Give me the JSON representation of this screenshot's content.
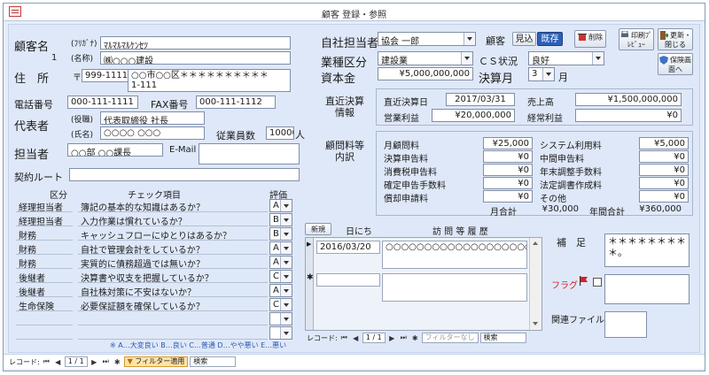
{
  "window": {
    "title": "顧客 登録・参照"
  },
  "customer": {
    "name_label": "顧客名",
    "kana_label": "(ﾌﾘｶﾞﾅ)",
    "kana": "ﾏﾙﾏﾙﾏﾙｹﾝｾﾂ",
    "id": "1",
    "name_sub_label": "(名称)",
    "name": "㈱○○○建設",
    "address_label": "住　所",
    "postal_mark": "〒",
    "postal": "999-1111",
    "address": "○○市○○区＊＊＊＊＊＊＊＊＊＊\n1-111",
    "phone_label": "電話番号",
    "phone": "000-111-1111",
    "fax_label": "FAX番号",
    "fax": "000-111-1112",
    "rep_label": "代表者",
    "rep_title_label": "(役職)",
    "rep_title": "代表取締役 社長",
    "rep_name_label": "(氏名)",
    "rep_name": "○○○○ ○○○",
    "employees_label": "従業員数",
    "employees": "10000",
    "employees_unit": "人",
    "contact_label": "担当者",
    "contact": "○○部 ○○課長",
    "email_label": "E-Mail",
    "email": "",
    "route_label": "契約ルート",
    "route": ""
  },
  "header_right": {
    "staff_label": "自社担当者",
    "staff": "協会 一郎",
    "customer_type_label": "顧客",
    "prospect_btn": "見込",
    "existing_btn": "既存",
    "industry_label": "業種区分",
    "industry": "建設業",
    "cs_label": "ＣＳ状況",
    "cs": "良好",
    "capital_label": "資本金",
    "capital": "¥5,000,000,000",
    "fiscal_label": "決算月",
    "fiscal_month": "3",
    "fiscal_unit": "月"
  },
  "toolbar": {
    "delete": "削除",
    "print_preview": "印刷ﾌﾟﾚﾋﾞｭｰ",
    "update_close": "更新・閉じる",
    "insurance_view": "保険画面へ"
  },
  "recent": {
    "section_label": "直近決算情報",
    "date_label": "直近決算日",
    "date": "2017/03/31",
    "sales_label": "売上高",
    "sales": "¥1,500,000,000",
    "op_profit_label": "営業利益",
    "op_profit": "¥20,000,000",
    "ord_profit_label": "経常利益",
    "ord_profit": "¥0"
  },
  "fees": {
    "section_label": "顧問料等内訳",
    "left": [
      {
        "label": "月顧問料",
        "value": "¥25,000"
      },
      {
        "label": "決算申告料",
        "value": "¥0"
      },
      {
        "label": "消費税申告料",
        "value": "¥0"
      },
      {
        "label": "確定申告手数料",
        "value": "¥0"
      },
      {
        "label": "償却申請料",
        "value": "¥0"
      }
    ],
    "right": [
      {
        "label": "システム利用料",
        "value": "¥5,000"
      },
      {
        "label": "中間申告料",
        "value": "¥0"
      },
      {
        "label": "年末調整手数料",
        "value": "¥0"
      },
      {
        "label": "法定調書作成料",
        "value": "¥0"
      },
      {
        "label": "その他",
        "value": "¥0"
      }
    ],
    "monthly_total_label": "月合計",
    "monthly_total": "¥30,000",
    "yearly_total_label": "年間合計",
    "yearly_total": "¥360,000"
  },
  "checklist": {
    "col_category": "区分",
    "col_item": "チェック項目",
    "col_eval": "評価",
    "rows": [
      {
        "category": "経理担当者",
        "item": "簿記の基本的な知識はあるか？",
        "eval": "A"
      },
      {
        "category": "経理担当者",
        "item": "入力作業は慣れているか？",
        "eval": "B"
      },
      {
        "category": "財務",
        "item": "キャッシュフローにゆとりはあるか？",
        "eval": "B"
      },
      {
        "category": "財務",
        "item": "自社で管理会計をしているか？",
        "eval": "A"
      },
      {
        "category": "財務",
        "item": "実質的に債務超過では無いか？",
        "eval": "A"
      },
      {
        "category": "後継者",
        "item": "決算書や収支を把握しているか？",
        "eval": "C"
      },
      {
        "category": "後継者",
        "item": "自社株対策に不安はないか？",
        "eval": "A"
      },
      {
        "category": "生命保険",
        "item": "必要保証額を確保しているか？",
        "eval": "C"
      },
      {
        "category": "",
        "item": "",
        "eval": ""
      },
      {
        "category": "",
        "item": "",
        "eval": ""
      }
    ],
    "legend": "※ A…大変良い B…良い C…普通 D…やや悪い E…悪い",
    "nav_label": "レコード:",
    "nav_pos": "1 / 1"
  },
  "visits": {
    "new_btn": "新規",
    "date_col": "日にち",
    "history_col": "訪 問 等 履 歴",
    "rows": [
      {
        "date": "2016/03/20",
        "text": "○○○○○○○○○○○○○○○○○○○○○"
      }
    ],
    "nav_label": "レコード:",
    "nav_pos": "1 / 1",
    "filter_label": "フィルターなし",
    "search_label": "検索"
  },
  "notes": {
    "remarks_label": "補　足",
    "remarks": "＊＊＊＊＊＊＊＊\n＊。",
    "flag_label": "フラグ",
    "related_label": "関連ファイル"
  },
  "statusbar": {
    "nav_label": "レコード:",
    "nav_pos": "1 / 1",
    "filter_label": "フィルター適用",
    "search_label": "検索"
  },
  "colors": {
    "window_bg": "#e6eefb",
    "existing_btn": "#2e5fb8",
    "flag": "#d6202a"
  }
}
